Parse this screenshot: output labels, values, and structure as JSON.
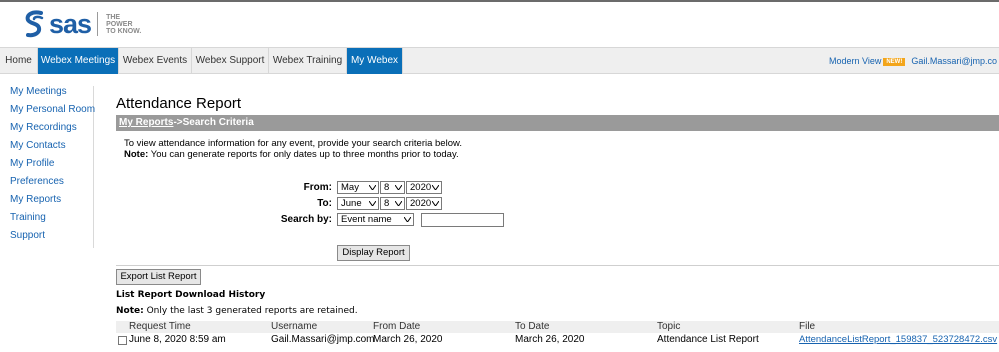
{
  "brand": {
    "name": "sas",
    "tagline_1": "THE",
    "tagline_2": "POWER",
    "tagline_3": "TO KNOW."
  },
  "nav": {
    "tabs": [
      {
        "label": "Home"
      },
      {
        "label": "Webex Meetings"
      },
      {
        "label": "Webex Events"
      },
      {
        "label": "Webex Support"
      },
      {
        "label": "Webex Training"
      },
      {
        "label": "My Webex"
      }
    ],
    "modern_view": "Modern View",
    "new_badge": "NEW!",
    "user": "Gail.Massari@jmp.co"
  },
  "sidebar": {
    "items": [
      {
        "label": "My Meetings"
      },
      {
        "label": "My Personal Room"
      },
      {
        "label": "My Recordings"
      },
      {
        "label": "My Contacts"
      },
      {
        "label": "My Profile"
      },
      {
        "label": "Preferences"
      },
      {
        "label": "My Reports"
      },
      {
        "label": "Training"
      },
      {
        "label": "Support"
      }
    ]
  },
  "page": {
    "title": "Attendance Report",
    "crumb_link": "My Reports",
    "crumb_rest": "->Search Criteria",
    "intro_line": "To view attendance information for any event, provide your search criteria below.",
    "note_label": "Note:",
    "note_text": " You can generate reports for only dates up to three months prior to today."
  },
  "form": {
    "from_label": "From:",
    "from_month": "May",
    "from_day": "8",
    "from_year": "2020",
    "to_label": "To:",
    "to_month": "June",
    "to_day": "8",
    "to_year": "2020",
    "search_label": "Search by:",
    "search_by": "Event name",
    "search_value": "",
    "display_button": "Display Report"
  },
  "history": {
    "export_button": "Export List Report",
    "title": "List Report Download History",
    "note_label": "Note:",
    "note_text": " Only the last 3 generated reports are retained.",
    "columns": {
      "request_time": "Request Time",
      "username": "Username",
      "from_date": "From Date",
      "to_date": "To Date",
      "topic": "Topic",
      "file": "File"
    },
    "rows": [
      {
        "request_time": "June 8, 2020 8:59 am",
        "username": "Gail.Massari@jmp.com",
        "from_date": "March 26, 2020",
        "to_date": "March 26, 2020",
        "topic": "Attendance List Report",
        "file": "AttendanceListReport_159837_523728472.csv"
      }
    ]
  },
  "colors": {
    "brand_blue": "#1f5fa6",
    "nav_active": "#0a6fb8",
    "link": "#1763b0",
    "crumb_bg": "#9a9a9a",
    "badge": "#f3a51b"
  }
}
